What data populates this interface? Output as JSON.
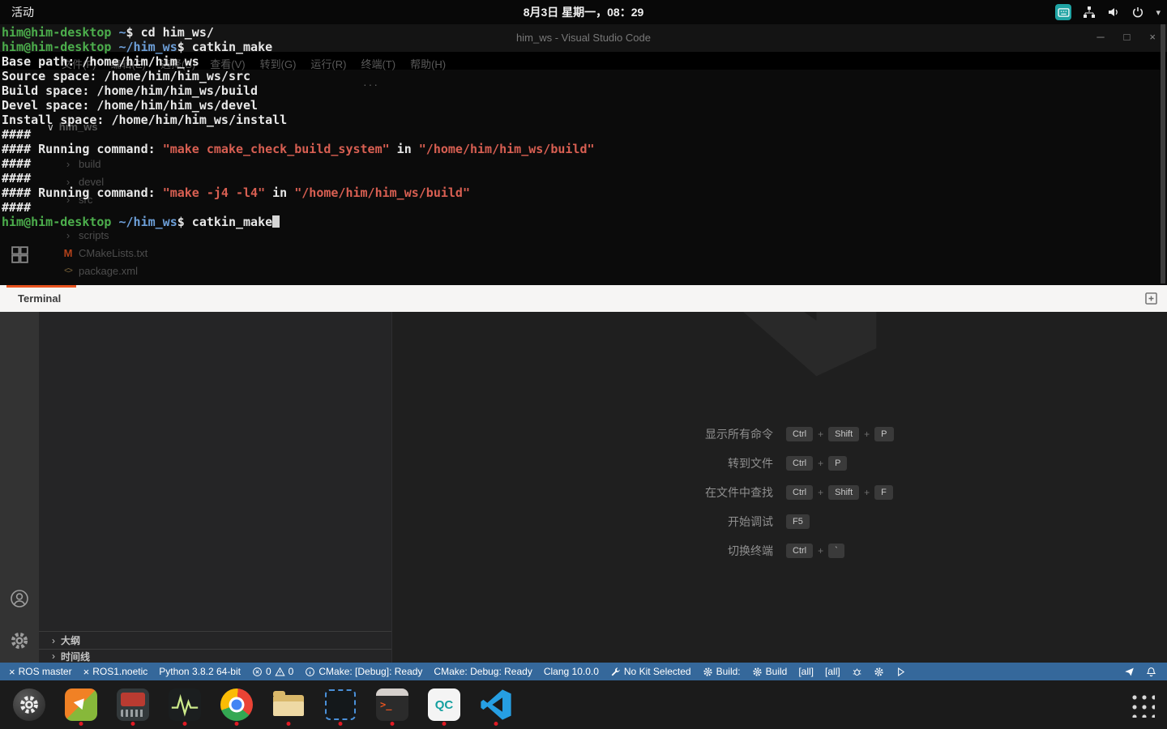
{
  "topbar": {
    "activities": "活动",
    "clock": "8月3日 星期一，08：29"
  },
  "window": {
    "title": "him_ws - Visual Studio Code",
    "menu": [
      "文件(F)",
      "编辑(E)",
      "选择(S)",
      "查看(V)",
      "转到(G)",
      "运行(R)",
      "终端(T)",
      "帮助(H)"
    ],
    "more_actions": "···",
    "explorer_root": "him_ws",
    "explorer_items": [
      {
        "label": "build",
        "type": "folder"
      },
      {
        "label": "devel",
        "type": "folder"
      },
      {
        "label": "src",
        "type": "folder"
      },
      {
        "label": "scripts",
        "type": "folder"
      },
      {
        "label": "CMakeLists.txt",
        "type": "cmake"
      },
      {
        "label": "package.xml",
        "type": "xml"
      }
    ]
  },
  "terminal": {
    "tab": "Terminal",
    "lines": [
      [
        {
          "c": "user",
          "t": "him@him-desktop"
        },
        {
          "c": "text",
          "t": " "
        },
        {
          "c": "path",
          "t": "~"
        },
        {
          "c": "text",
          "t": "$ cd him_ws/"
        }
      ],
      [
        {
          "c": "user",
          "t": "him@him-desktop"
        },
        {
          "c": "text",
          "t": " "
        },
        {
          "c": "path",
          "t": "~/him_ws"
        },
        {
          "c": "text",
          "t": "$ catkin_make"
        }
      ],
      [
        {
          "c": "text",
          "t": "Base path: /home/him/him_ws"
        }
      ],
      [
        {
          "c": "text",
          "t": "Source space: /home/him/him_ws/src"
        }
      ],
      [
        {
          "c": "text",
          "t": "Build space: /home/him/him_ws/build"
        }
      ],
      [
        {
          "c": "text",
          "t": "Devel space: /home/him/him_ws/devel"
        }
      ],
      [
        {
          "c": "text",
          "t": "Install space: /home/him/him_ws/install"
        }
      ],
      [
        {
          "c": "text",
          "t": "####"
        }
      ],
      [
        {
          "c": "text",
          "t": "#### Running command: "
        },
        {
          "c": "quote",
          "t": "\"make cmake_check_build_system\""
        },
        {
          "c": "text",
          "t": " in "
        },
        {
          "c": "quote",
          "t": "\"/home/him/him_ws/build\""
        }
      ],
      [
        {
          "c": "text",
          "t": "####"
        }
      ],
      [
        {
          "c": "text",
          "t": "####"
        }
      ],
      [
        {
          "c": "text",
          "t": "#### Running command: "
        },
        {
          "c": "quote",
          "t": "\"make -j4 -l4\""
        },
        {
          "c": "text",
          "t": " in "
        },
        {
          "c": "quote",
          "t": "\"/home/him/him_ws/build\""
        }
      ],
      [
        {
          "c": "text",
          "t": "####"
        }
      ],
      [
        {
          "c": "user",
          "t": "him@him-desktop"
        },
        {
          "c": "text",
          "t": " "
        },
        {
          "c": "path",
          "t": "~/him_ws"
        },
        {
          "c": "text",
          "t": "$ catkin_make"
        },
        {
          "c": "cursor",
          "t": " "
        }
      ]
    ]
  },
  "welcome": {
    "shortcuts": [
      {
        "label": "显示所有命令",
        "keys": [
          "Ctrl",
          "Shift",
          "P"
        ]
      },
      {
        "label": "转到文件",
        "keys": [
          "Ctrl",
          "P"
        ]
      },
      {
        "label": "在文件中查找",
        "keys": [
          "Ctrl",
          "Shift",
          "F"
        ]
      },
      {
        "label": "开始调试",
        "keys": [
          "F5"
        ]
      },
      {
        "label": "切换终端",
        "keys": [
          "Ctrl",
          "`"
        ]
      }
    ]
  },
  "sidebar_sections": {
    "outline": "大纲",
    "timeline": "时间线"
  },
  "statusbar": {
    "left": [
      [
        {
          "i": "x"
        },
        {
          "t": "ROS master"
        }
      ],
      [
        {
          "i": "x"
        },
        {
          "t": "ROS1.noetic"
        }
      ],
      [
        {
          "t": "Python 3.8.2 64-bit"
        }
      ],
      [
        {
          "i": "error"
        },
        {
          "t": "0"
        },
        {
          "i": "warn"
        },
        {
          "t": "0"
        }
      ],
      [
        {
          "i": "info"
        },
        {
          "t": "CMake: [Debug]: Ready"
        }
      ],
      [
        {
          "t": "CMake: Debug: Ready"
        }
      ],
      [
        {
          "t": "Clang 10.0.0"
        }
      ],
      [
        {
          "i": "wrench"
        },
        {
          "t": "No Kit Selected"
        }
      ],
      [
        {
          "i": "gear"
        },
        {
          "t": "Build:"
        }
      ],
      [
        {
          "i": "gear"
        },
        {
          "t": "Build"
        }
      ],
      [
        {
          "t": "[all]"
        }
      ],
      [
        {
          "t": "[all]"
        }
      ],
      [
        {
          "i": "bug"
        }
      ],
      [
        {
          "i": "gear"
        }
      ],
      [
        {
          "i": "play"
        }
      ]
    ],
    "right": [
      [
        {
          "i": "feedback"
        }
      ],
      [
        {
          "i": "bell"
        }
      ]
    ]
  },
  "dock": {
    "apps": [
      {
        "id": "settings",
        "running": false
      },
      {
        "id": "software",
        "running": true
      },
      {
        "id": "boxes",
        "running": true
      },
      {
        "id": "scope",
        "running": true
      },
      {
        "id": "chrome",
        "running": true
      },
      {
        "id": "files",
        "running": true
      },
      {
        "id": "select",
        "running": true
      },
      {
        "id": "terminal",
        "running": true
      },
      {
        "id": "qgc",
        "label": "QC",
        "running": true
      },
      {
        "id": "vscode",
        "running": true
      }
    ]
  },
  "colors": {
    "ubuntu_orange": "#e9541f",
    "statusbar_blue": "#35689b",
    "terminal_user_green": "#4cae4c",
    "terminal_path_blue": "#6d9fd8",
    "terminal_quote_red": "#d85f52",
    "running_dot_red": "#e01b24"
  }
}
